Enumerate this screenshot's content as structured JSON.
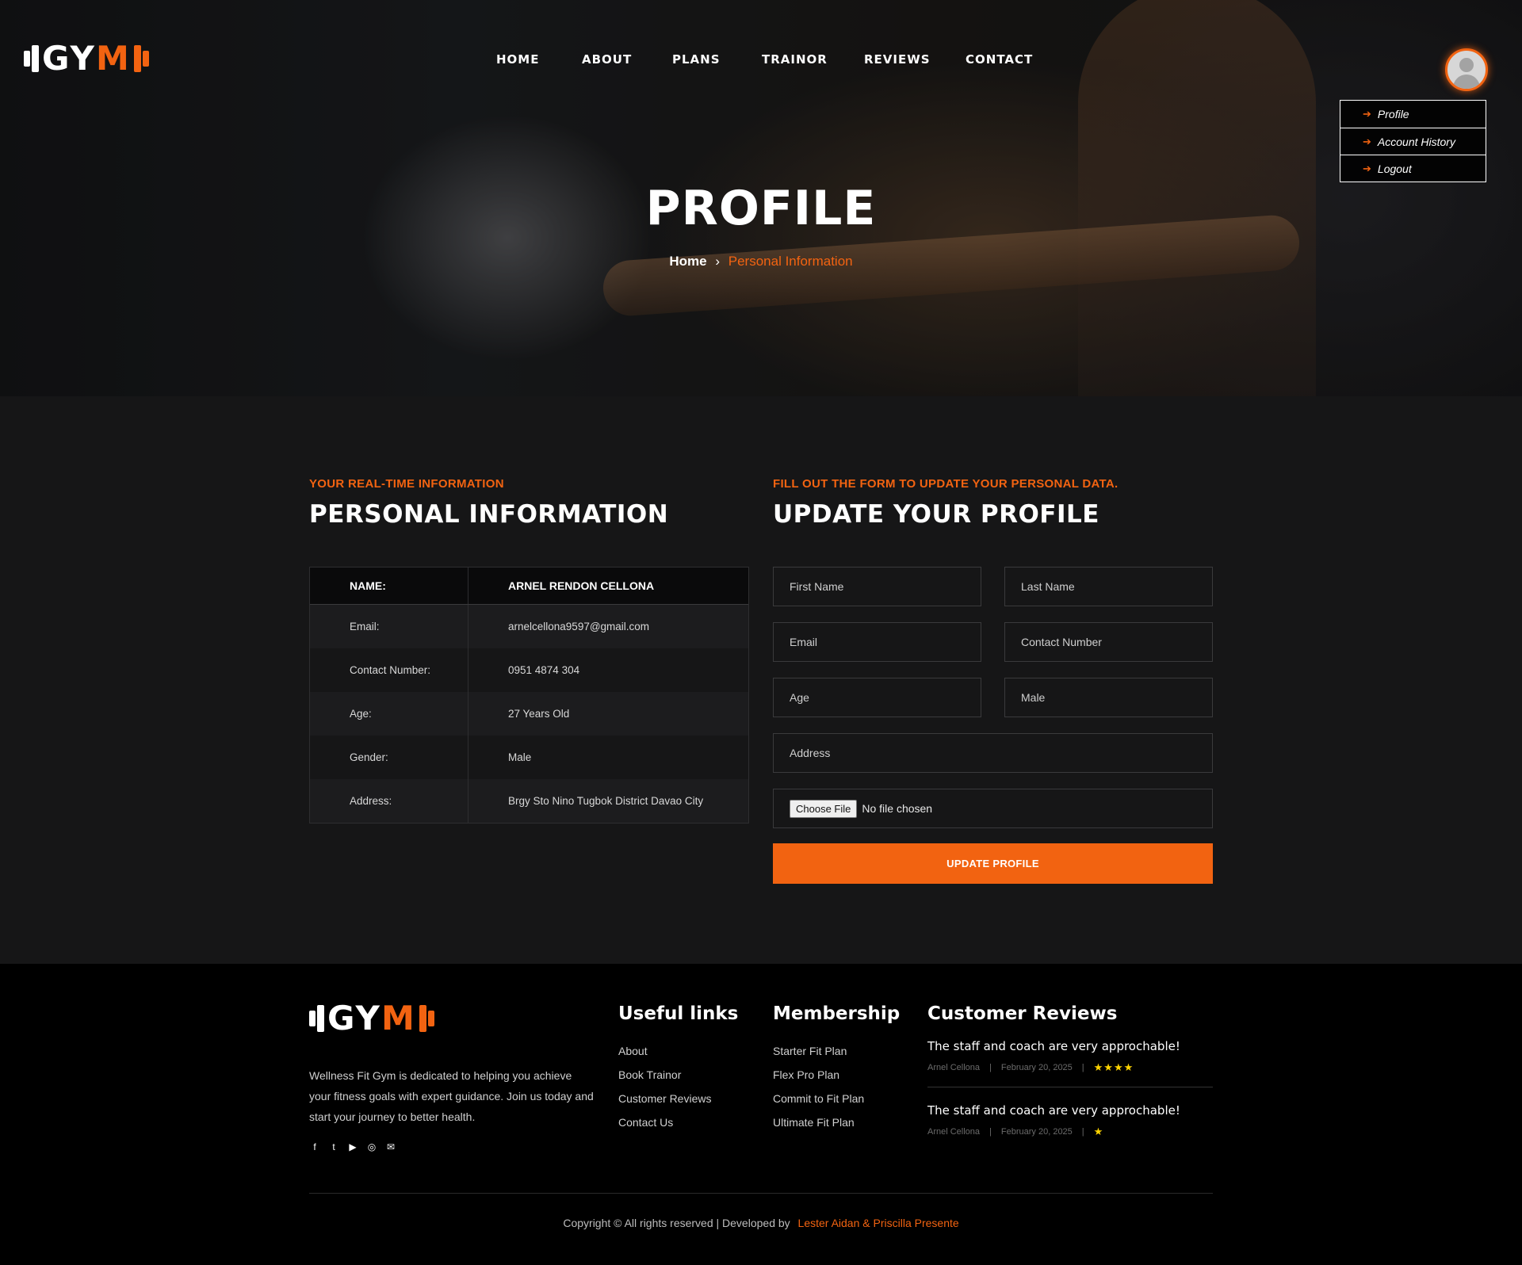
{
  "brand": {
    "logo_left": "GY",
    "logo_right": "M"
  },
  "nav": [
    "HOME",
    "ABOUT",
    "PLANS",
    "TRAINOR",
    "REVIEWS",
    "CONTACT"
  ],
  "user_menu": {
    "items": [
      "Profile",
      "Account History",
      "Logout"
    ]
  },
  "hero": {
    "title": "PROFILE",
    "breadcrumb_home": "Home",
    "breadcrumb_sep": "›",
    "breadcrumb_current": "Personal Information"
  },
  "personal": {
    "eyebrow": "YOUR REAL-TIME INFORMATION",
    "title": "PERSONAL INFORMATION",
    "header": {
      "label": "NAME:",
      "value": "ARNEL RENDON CELLONA"
    },
    "rows": [
      {
        "label": "Email:",
        "value": "arnelcellona9597@gmail.com"
      },
      {
        "label": "Contact Number:",
        "value": "0951 4874 304"
      },
      {
        "label": "Age:",
        "value": "27 Years Old"
      },
      {
        "label": "Gender:",
        "value": "Male"
      },
      {
        "label": "Address:",
        "value": "Brgy Sto Nino Tugbok District Davao City"
      }
    ]
  },
  "update": {
    "eyebrow": "FILL OUT THE FORM TO UPDATE YOUR PERSONAL DATA.",
    "title": "UPDATE YOUR PROFILE",
    "first_name": "First Name",
    "last_name": "Last Name",
    "email": "Email",
    "contact": "Contact Number",
    "age": "Age",
    "gender": "Male",
    "address": "Address",
    "file_button": "Choose File",
    "file_status": "No file chosen",
    "submit": "UPDATE PROFILE"
  },
  "footer": {
    "description": "Wellness Fit Gym is dedicated to helping you achieve your fitness goals with expert guidance. Join us today and start your journey to better health.",
    "socials": [
      "facebook-icon",
      "twitter-icon",
      "youtube-icon",
      "instagram-icon",
      "mail-icon"
    ],
    "useful_title": "Useful links",
    "useful_links": [
      "About",
      "Book Trainor",
      "Customer Reviews",
      "Contact Us"
    ],
    "membership_title": "Membership",
    "membership_links": [
      "Starter Fit Plan",
      "Flex Pro Plan",
      "Commit to Fit Plan",
      "Ultimate Fit Plan"
    ],
    "reviews_title": "Customer Reviews",
    "reviews": [
      {
        "text": "The staff and coach are very approchable!",
        "author": "Arnel Cellona",
        "date": "February 20, 2025",
        "stars": "★★★★"
      },
      {
        "text": "The staff and coach are very approchable!",
        "author": "Arnel Cellona",
        "date": "February 20, 2025",
        "stars": "★"
      }
    ],
    "copyright": "Copyright © All rights reserved | Developed by",
    "developers": "Lester Aidan & Priscilla Presente"
  },
  "colors": {
    "accent": "#f26311",
    "background": "#161617",
    "footer": "#000000"
  }
}
